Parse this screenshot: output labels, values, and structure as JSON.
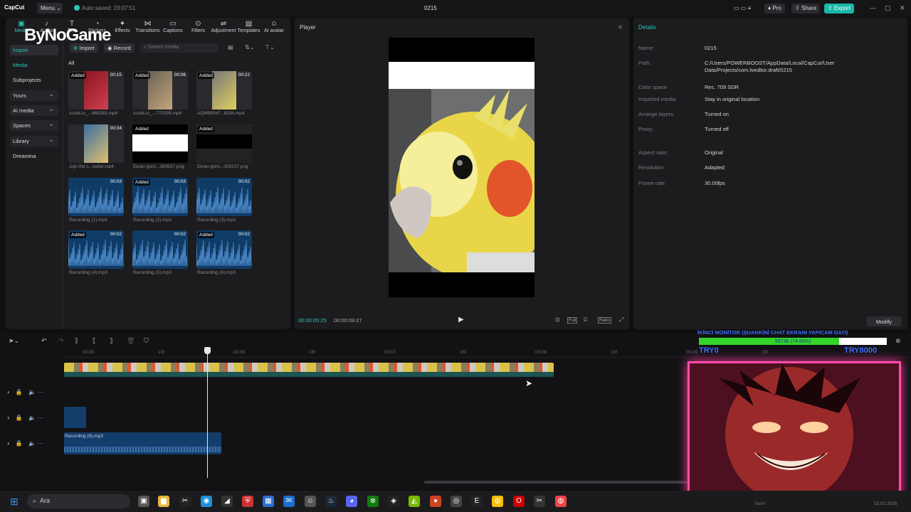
{
  "titlebar": {
    "logo": "CapCut",
    "menu_label": "Menu",
    "autosave": "Auto saved: 23:07:51",
    "project_name": "0215",
    "pro_label": "Pro",
    "share_label": "Share",
    "export_label": "Export"
  },
  "watermark": "ByNoGame",
  "toolbar": {
    "items": [
      {
        "label": "Media",
        "icon": "media-icon"
      },
      {
        "label": "Audio",
        "icon": "audio-icon"
      },
      {
        "label": "Text",
        "icon": "text-icon"
      },
      {
        "label": "Stickers",
        "icon": "sticker-icon"
      },
      {
        "label": "Effects",
        "icon": "effects-icon"
      },
      {
        "label": "Transitions",
        "icon": "transitions-icon"
      },
      {
        "label": "Captions",
        "icon": "captions-icon"
      },
      {
        "label": "Filters",
        "icon": "filters-icon"
      },
      {
        "label": "Adjustment",
        "icon": "adjustment-icon"
      },
      {
        "label": "Templates",
        "icon": "templates-icon"
      },
      {
        "label": "AI avatar",
        "icon": "ai-avatar-icon"
      }
    ]
  },
  "sidebar": {
    "items": [
      "Import",
      "Media",
      "Subprojects",
      "Yours",
      "AI media",
      "Spaces",
      "Library",
      "Dreamina"
    ]
  },
  "media": {
    "import_label": "Import",
    "record_label": "Record",
    "search_placeholder": "Search media",
    "filter_all": "All",
    "items": [
      {
        "name": "ssstik.io_...668283.mp4",
        "added": "Added",
        "duration": "00:15",
        "kind": "video-red"
      },
      {
        "name": "ssstik.io_...770295.mp4",
        "added": "Added",
        "duration": "00:06",
        "kind": "video-grey"
      },
      {
        "name": "AQM990xF...833b.mp4",
        "added": "Added",
        "duration": "00:22",
        "kind": "video-yellow"
      },
      {
        "name": "Jojo the c...ketiel.mp4",
        "added": "",
        "duration": "00:34",
        "kind": "video-blue"
      },
      {
        "name": "Ekran görü...160837.png",
        "added": "Added",
        "duration": "",
        "kind": "white"
      },
      {
        "name": "Ekran görü...005107.png",
        "added": "Added",
        "duration": "",
        "kind": "black"
      },
      {
        "name": "Recording (1).mp3",
        "added": "",
        "duration": "00:03",
        "kind": "wave"
      },
      {
        "name": "Recording (2).mp3",
        "added": "Added",
        "duration": "00:03",
        "kind": "wave"
      },
      {
        "name": "Recording (3).mp3",
        "added": "",
        "duration": "00:02",
        "kind": "wave"
      },
      {
        "name": "Recording (4).mp3",
        "added": "Added",
        "duration": "00:02",
        "kind": "wave"
      },
      {
        "name": "Recording (5).mp3",
        "added": "",
        "duration": "00:02",
        "kind": "wave"
      },
      {
        "name": "Recording (6).mp3",
        "added": "Added",
        "duration": "00:02",
        "kind": "wave"
      }
    ]
  },
  "player": {
    "title": "Player",
    "current_time": "00:00:05:25",
    "total_time": "00:00:09:27",
    "full_label": "Full",
    "ratio_label": "Ratio"
  },
  "details": {
    "title": "Details",
    "rows": [
      {
        "key": "Name:",
        "value": "0215"
      },
      {
        "key": "Path:",
        "value": "C:/Users/POWERBOOST/AppData/Local/CapCut/User Data/Projects/com.lveditor.draft/0215"
      },
      {
        "key": "Color space",
        "value": "Rec. 709 SDR"
      },
      {
        "key": "Imported media:",
        "value": "Stay in original location"
      },
      {
        "key": "Arrange layers",
        "value": "Turned on"
      },
      {
        "key": "Proxy:",
        "value": "Turned off"
      },
      {
        "key": "Aspect ratio:",
        "value": "Original"
      },
      {
        "key": "Resolution:",
        "value": "Adapted"
      },
      {
        "key": "Frame rate:",
        "value": "30.00fps"
      }
    ],
    "modify_label": "Modify"
  },
  "timeline": {
    "ruler": [
      "00:05",
      "15f",
      "00:06",
      "15f",
      "00:07",
      "15f",
      "00:08",
      "15f",
      "00:09",
      "15f"
    ],
    "audio_clip_label": "Recording (6).mp3"
  },
  "stream_overlay": {
    "banner": "İKİNCİ MONİTOR (ŞUANKİNİ CHAT EKRANI YAPICAM DAYI)",
    "progress_text": "5973₺ (74.66%)",
    "progress_value": 0.7466,
    "left_label": "TRY0",
    "right_label": "TRY8000"
  },
  "taskbar": {
    "search_label": "Ara",
    "clock_day": "Yarın",
    "clock_date": "15.02.2026"
  }
}
